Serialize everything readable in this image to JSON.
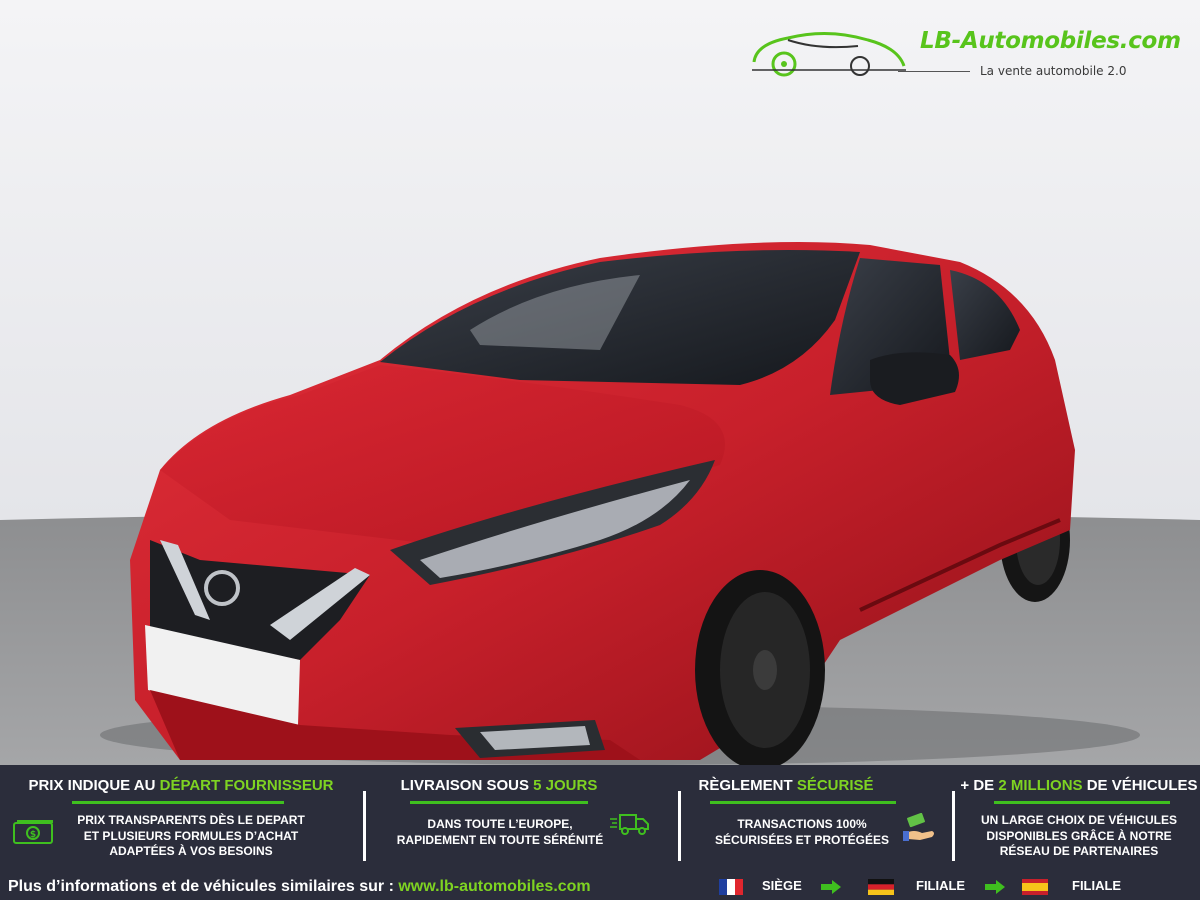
{
  "logo": {
    "name": "LB-Automobiles.com",
    "tagline": "La vente automobile 2.0"
  },
  "photo": {
    "subject": "red-hatchback-car",
    "body_color": "#c8202b"
  },
  "features": [
    {
      "title_pre": "PRIX INDIQUE AU ",
      "title_hl": "DÉPART FOURNISSEUR",
      "title_post": "",
      "lines": [
        "PRIX TRANSPARENTS DÈS LE DEPART",
        "ET PLUSIEURS FORMULES D’ACHAT",
        "ADAPTÉES À VOS BESOINS"
      ],
      "icon": "banknote-icon"
    },
    {
      "title_pre": "LIVRAISON SOUS ",
      "title_hl": "5 JOURS",
      "title_post": "",
      "lines": [
        "DANS TOUTE L’EUROPE,",
        "RAPIDEMENT EN TOUTE SÉRÉNITÉ"
      ],
      "icon": "delivery-truck-icon"
    },
    {
      "title_pre": "RÈGLEMENT ",
      "title_hl": "SÉCURISÉ",
      "title_post": "",
      "lines": [
        "TRANSACTIONS 100%",
        "SÉCURISÉES ET PROTÉGÉES"
      ],
      "icon": "money-hand-icon"
    },
    {
      "title_pre": "+ DE ",
      "title_hl": "2 MILLIONS",
      "title_post": " DE VÉHICULES",
      "lines": [
        "UN LARGE CHOIX DE VÉHICULES",
        "DISPONIBLES GRÂCE À NOTRE",
        "RÉSEAU DE PARTENAIRES"
      ],
      "icon": ""
    }
  ],
  "footer": {
    "text": "Plus d’informations et de véhicules similaires sur : ",
    "link": "www.lb-automobiles.com"
  },
  "branches": [
    {
      "flag": "france-flag",
      "label": "SIÈGE"
    },
    {
      "flag": "germany-flag",
      "label": "FILIALE"
    },
    {
      "flag": "spain-flag",
      "label": "FILIALE"
    }
  ],
  "colors": {
    "accent_green": "#7ed322",
    "banner_bg": "#2b2d3b",
    "logo_green": "#58c41c"
  }
}
